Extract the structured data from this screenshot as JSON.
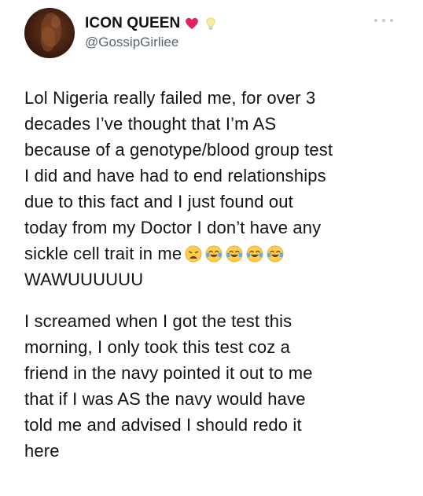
{
  "author": {
    "display_name": "ICON QUEEN",
    "handle": "@GossipGirliee",
    "name_emojis": [
      "red-heart-icon",
      "lightbulb-icon"
    ]
  },
  "tweet": {
    "paragraph_1_lines": [
      "Lol Nigeria really failed me, for over 3",
      "decades I’ve thought that I’m AS",
      "because of a genotype/blood group test",
      "I did and have had to end relationships",
      "due to this fact and I just found out",
      "today from my Doctor I don’t have any",
      "sickle cell trait in me",
      "WAWUUUUUU"
    ],
    "paragraph_1_emojis": [
      "weary-face-icon",
      "tears-of-joy-icon",
      "tears-of-joy-icon",
      "tears-of-joy-icon",
      "tears-of-joy-icon"
    ],
    "paragraph_2_lines": [
      "I screamed when I got the test this",
      "morning, I only took this test coz a",
      "friend in the navy pointed it out to me",
      "that if I was AS the navy would have",
      "told me and advised I should redo it",
      "here"
    ]
  },
  "colors": {
    "text": "#0f1419",
    "secondary": "#536471",
    "heart": "#e0245e",
    "more_dots": "#c4ccd2"
  }
}
